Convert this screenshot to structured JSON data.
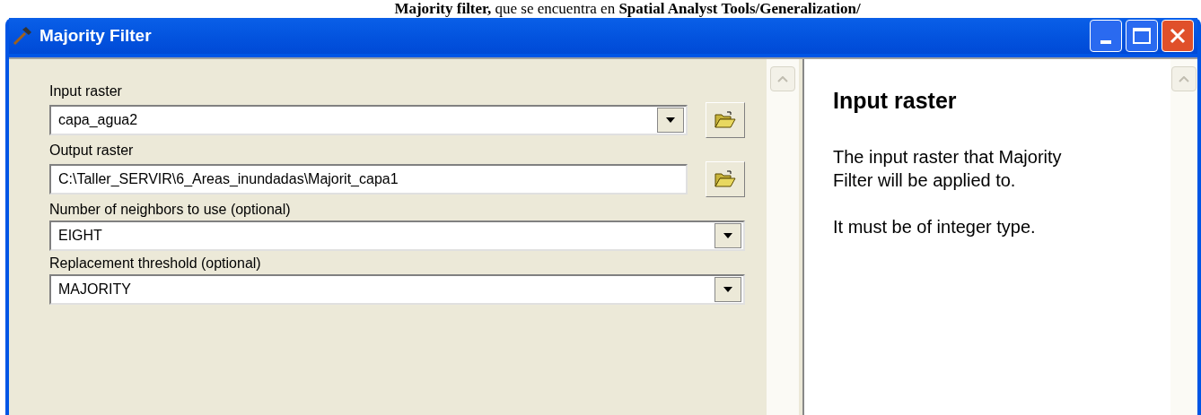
{
  "caption": "**Majority filter,** que se encuentra en **Spatial Analyst Tools/Generalization/**",
  "window": {
    "title": "Majority Filter"
  },
  "parameters": [
    {
      "label": "Input raster",
      "value": "capa_agua2",
      "kind": "dropdown",
      "browse": true
    },
    {
      "label": "Output raster",
      "value": "C:\\Taller_SERVIR\\6_Areas_inundadas\\Majorit_capa1",
      "kind": "text",
      "browse": true
    },
    {
      "label": "Number of neighbors to use (optional)",
      "value": "EIGHT",
      "kind": "dropdown",
      "browse": false
    },
    {
      "label": "Replacement threshold (optional)",
      "value": "MAJORITY",
      "kind": "dropdown",
      "browse": false
    }
  ],
  "help": {
    "title": "Input raster",
    "paragraphs": [
      "The input raster that Majority Filter will be applied to.",
      "It must be of integer type."
    ]
  }
}
